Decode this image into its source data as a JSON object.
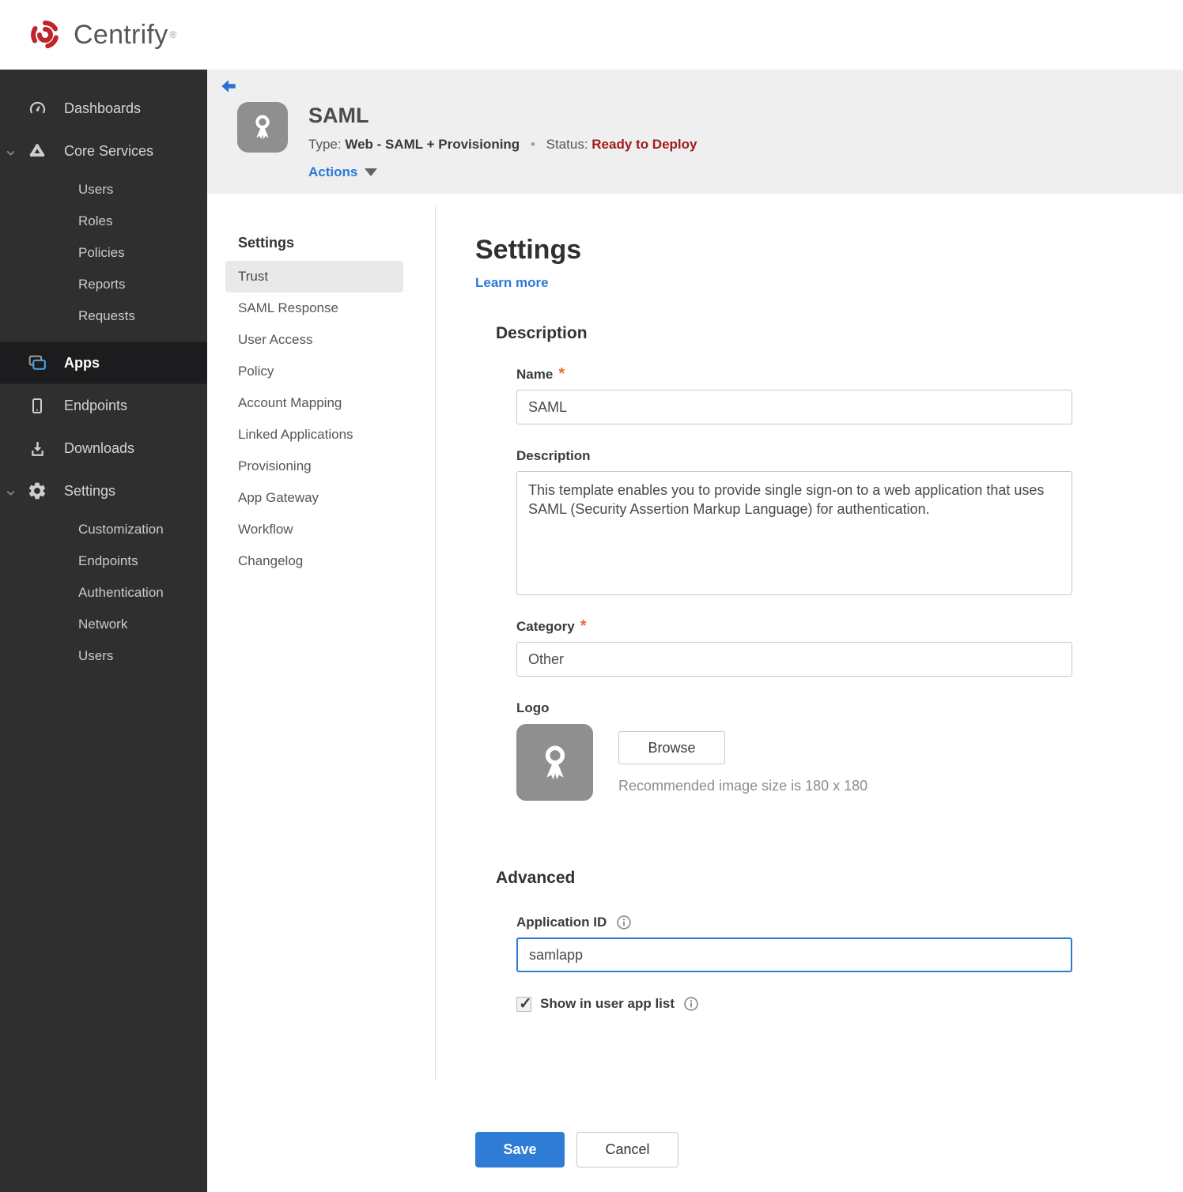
{
  "brand": {
    "name": "Centrify",
    "registered": "®"
  },
  "sidebar": {
    "items": [
      {
        "label": "Dashboards"
      },
      {
        "label": "Core Services"
      },
      {
        "label": "Users"
      },
      {
        "label": "Roles"
      },
      {
        "label": "Policies"
      },
      {
        "label": "Reports"
      },
      {
        "label": "Requests"
      },
      {
        "label": "Apps"
      },
      {
        "label": "Endpoints"
      },
      {
        "label": "Downloads"
      },
      {
        "label": "Settings"
      },
      {
        "label": "Customization"
      },
      {
        "label": "Endpoints"
      },
      {
        "label": "Authentication"
      },
      {
        "label": "Network"
      },
      {
        "label": "Users"
      }
    ]
  },
  "header": {
    "title": "SAML",
    "type_label": "Type:",
    "type_value": "Web - SAML + Provisioning",
    "separator": "•",
    "status_label": "Status:",
    "status_value": "Ready to Deploy",
    "actions_label": "Actions"
  },
  "subnav": {
    "header": "Settings",
    "active_item": "Trust",
    "items": [
      "Trust",
      "SAML Response",
      "User Access",
      "Policy",
      "Account Mapping",
      "Linked Applications",
      "Provisioning",
      "App Gateway",
      "Workflow",
      "Changelog"
    ]
  },
  "main": {
    "heading": "Settings",
    "learn_more": "Learn more",
    "required_marker": "*",
    "description_section": {
      "heading": "Description",
      "name_label": "Name",
      "name_value": "SAML",
      "description_label": "Description",
      "description_value": "This template enables you to provide single sign-on to a web application that uses SAML (Security Assertion Markup Language) for authentication.",
      "category_label": "Category",
      "category_value": "Other",
      "logo_label": "Logo",
      "browse_label": "Browse",
      "logo_hint": "Recommended image size is 180 x 180"
    },
    "advanced_section": {
      "heading": "Advanced",
      "application_id_label": "Application ID",
      "application_id_value": "samlapp",
      "show_in_user_app_list_label": "Show in user app list",
      "show_in_user_app_list_checked": true
    },
    "save_label": "Save",
    "cancel_label": "Cancel"
  },
  "colors": {
    "accent_blue": "#2a78d9",
    "save_button": "#2e7cd6",
    "status_red": "#a01b1e",
    "asterisk_orange": "#ee6b33",
    "sidebar_bg": "#2f2f30",
    "sidebar_active_bg": "#1c1c1e",
    "header_band_bg": "#efeff0"
  }
}
